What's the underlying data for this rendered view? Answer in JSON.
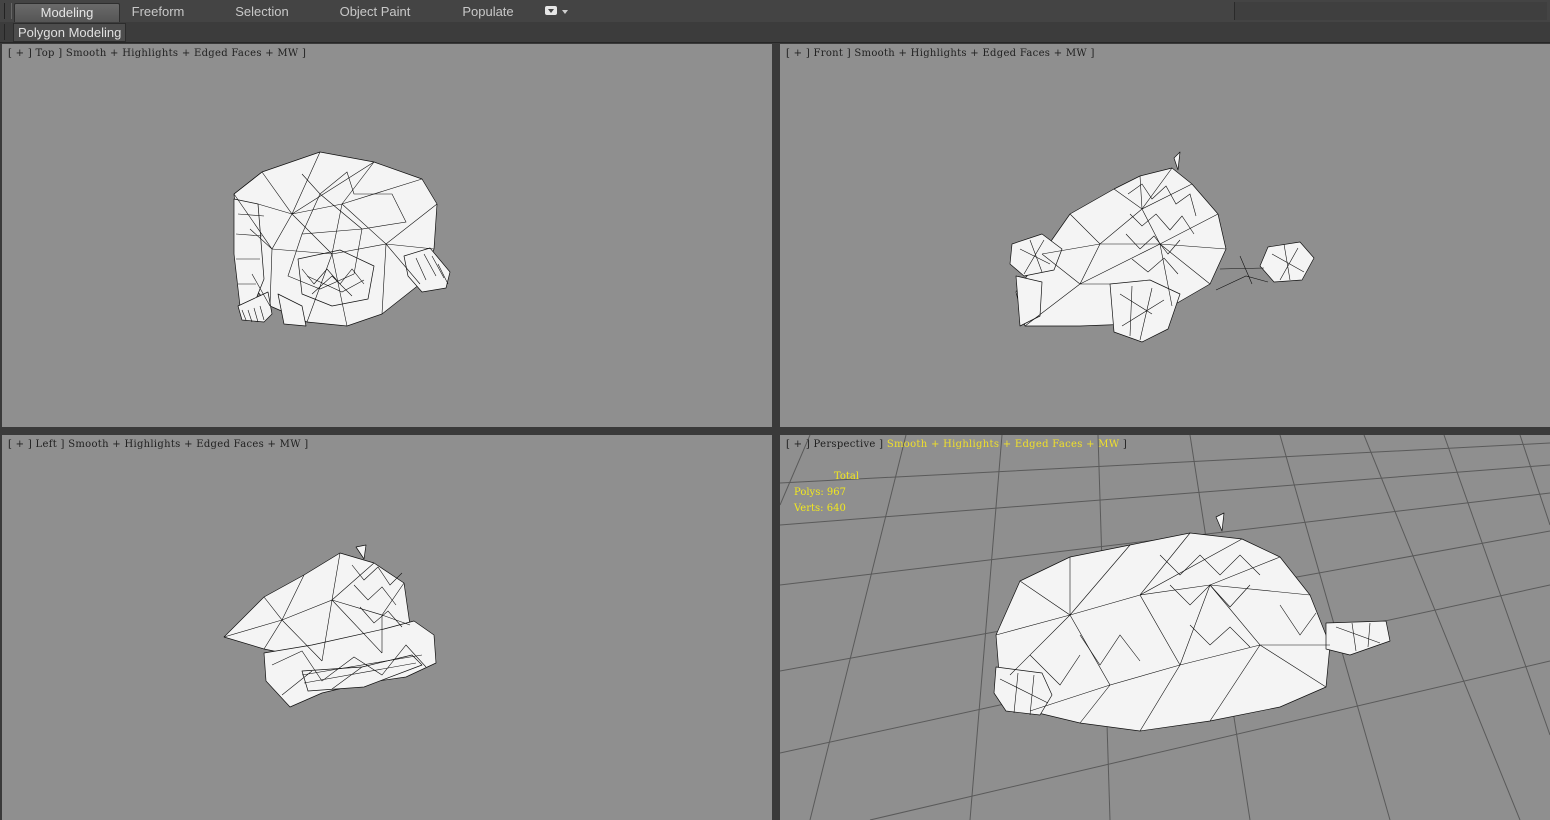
{
  "ribbon": {
    "tabs": [
      {
        "label": "Modeling",
        "active": true
      },
      {
        "label": "Freeform",
        "active": false
      },
      {
        "label": "Selection",
        "active": false
      },
      {
        "label": "Object Paint",
        "active": false
      },
      {
        "label": "Populate",
        "active": false
      }
    ],
    "menu_icon": "ribbon-options-icon",
    "panel_label": "Polygon Modeling"
  },
  "viewports": [
    {
      "id": "top",
      "view": "Top",
      "shading": "Smooth + Highlights + Edged Faces + MW"
    },
    {
      "id": "front",
      "view": "Front",
      "shading": "Smooth + Highlights + Edged Faces + MW"
    },
    {
      "id": "left",
      "view": "Left",
      "shading": "Smooth + Highlights + Edged Faces + MW"
    },
    {
      "id": "perspective",
      "view": "Perspective",
      "shading": "Smooth + Highlights + Edged Faces + MW",
      "shading_highlighted": true
    }
  ],
  "stats": {
    "header": "Total",
    "polys_label": "Polys:",
    "polys": "967",
    "verts_label": "Verts:",
    "verts": "640"
  },
  "colors": {
    "viewport_bg": "#8f8f8f",
    "mesh_fill": "#f4f4f4",
    "mesh_edge": "#111111",
    "grid": "#5a5a5a",
    "stats_text": "#f2e81e",
    "active_shading_label": "#f0e02a"
  }
}
